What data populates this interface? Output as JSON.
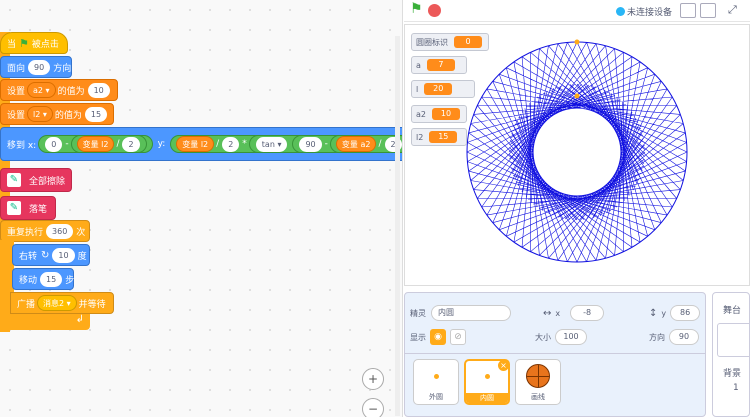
{
  "blocks": {
    "when_flag": {
      "pre": "当",
      "post": "被点击"
    },
    "point_dir": {
      "pre": "面向",
      "val": "90",
      "post": "方向"
    },
    "set_a2": {
      "pre": "设置",
      "var": "a2 ▾",
      "mid": "的值为",
      "val": "10"
    },
    "set_l2": {
      "pre": "设置",
      "var": "l2 ▾",
      "mid": "的值为",
      "val": "15"
    },
    "goto": {
      "pre": "移到 x:",
      "zero": "0",
      "minus": "-",
      "var1": "变量 l2",
      "div1": "/",
      "two1": "2",
      "ylabel": "y:",
      "var2": "变量 l2",
      "div2": "/",
      "two2": "2",
      "mul": "*",
      "fn": "tan ▾",
      "ninety": "90",
      "minus2": "-",
      "var3": "变量 a2",
      "div3": "/",
      "two3": "2"
    },
    "clear": {
      "label": "全部擦除"
    },
    "pen_down": {
      "label": "落笔"
    },
    "repeat": {
      "pre": "重复执行",
      "val": "360",
      "post": "次"
    },
    "turn": {
      "pre": "右转",
      "val": "10",
      "post": "度"
    },
    "move": {
      "pre": "移动",
      "val": "15",
      "post": "步"
    },
    "broadcast": {
      "pre": "广播",
      "msg": "消息2 ▾",
      "post": "并等待"
    }
  },
  "zoom": {
    "in": "+",
    "out": "−"
  },
  "topbar": {
    "status": "未连接设备"
  },
  "monitors": [
    {
      "label": "圆圈标识",
      "value": "0"
    },
    {
      "label": "a",
      "value": "7"
    },
    {
      "label": "l",
      "value": "20"
    },
    {
      "label": "a2",
      "value": "10"
    },
    {
      "label": "l2",
      "value": "15"
    }
  ],
  "sprite_info": {
    "sprite_label": "精灵",
    "sprite_name": "内圆",
    "x_label": "x",
    "x_val": "-8",
    "y_label": "y",
    "y_val": "86",
    "show_label": "显示",
    "size_label": "大小",
    "size_val": "100",
    "dir_label": "方向",
    "dir_val": "90"
  },
  "sprite_tiles": [
    {
      "name": "外圆"
    },
    {
      "name": "内圆"
    },
    {
      "name": "画线"
    }
  ],
  "backdrop": {
    "title": "舞台",
    "label": "背景",
    "count": "1"
  },
  "colors": {
    "pen": "#1010e0",
    "selected": "#ffab19"
  }
}
